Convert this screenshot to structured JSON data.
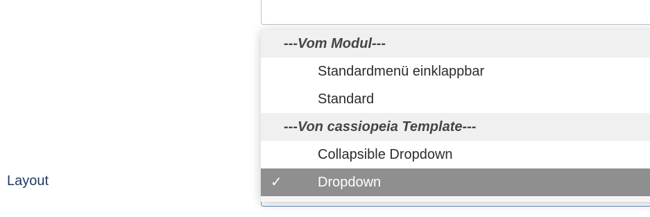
{
  "form": {
    "layout_label": "Layout"
  },
  "dropdown": {
    "options": [
      {
        "label": "---Vom Modul---",
        "type": "group"
      },
      {
        "label": "Standardmenü einklappbar",
        "type": "option"
      },
      {
        "label": "Standard",
        "type": "option"
      },
      {
        "label": "---Von cassiopeia Template---",
        "type": "group"
      },
      {
        "label": "Collapsible Dropdown",
        "type": "option"
      },
      {
        "label": "Dropdown",
        "type": "option",
        "selected": true
      }
    ],
    "check_icon": "✓",
    "colors": {
      "selected_bg": "#8f8f8f",
      "group_bg": "#f0f0f0",
      "focus_border": "#5f8fc4",
      "label_color": "#1e3a5f"
    }
  }
}
